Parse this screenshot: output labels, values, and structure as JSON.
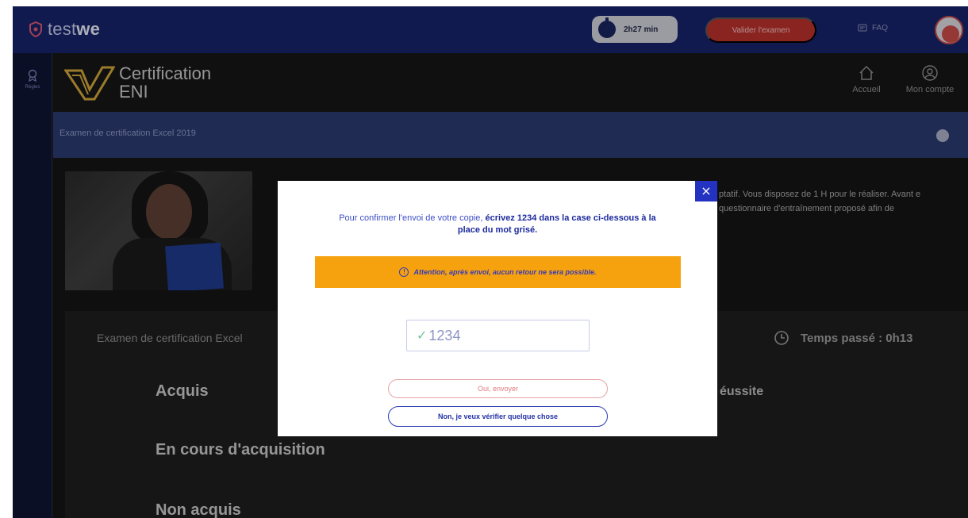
{
  "topbar": {
    "brand_light": "test",
    "brand_bold": "we",
    "timer": "2h27 min",
    "validate_label": "Valider l'examen",
    "faq_label": "FAQ"
  },
  "rail": {
    "item_label": "Règles"
  },
  "header": {
    "title_line1": "Certification",
    "title_line2": "ENI",
    "nav_home": "Accueil",
    "nav_account": "Mon compte"
  },
  "band": {
    "title": "Examen de certification Excel 2019"
  },
  "intro": {
    "text": "ptatif. Vous disposez de 1 H pour le réaliser. Avant e questionnaire d'entraînement proposé afin de"
  },
  "results": {
    "title": "Examen de certification Excel",
    "elapsed": "Temps passé : 0h13",
    "levels": [
      "Acquis",
      "En cours d'acquisition",
      "Non acquis"
    ],
    "reussite": "éussite"
  },
  "modal": {
    "close": "×",
    "text_before": "Pour confirmer l'envoi de votre copie, ",
    "text_bold": "écrivez 1234 dans la case ci-dessous à la place du mot grisé.",
    "warning": "Attention, après envoi, aucun retour ne sera possible.",
    "input_value": "1234",
    "send_label": "Oui, envoyer",
    "verify_label": "Non, je veux vérifier quelque chose"
  },
  "colors": {
    "topbar": "#17236a",
    "band": "#2b3a70",
    "validate": "#b9302c",
    "warning": "#f6a20f",
    "modal_accent": "#2432c2"
  }
}
